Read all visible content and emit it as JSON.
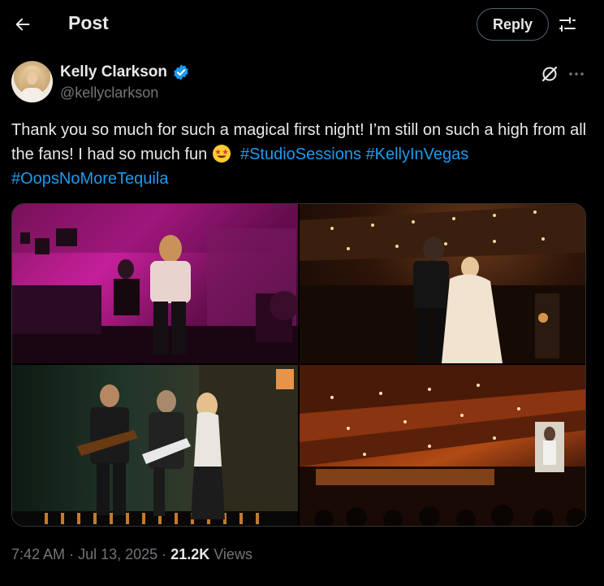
{
  "header": {
    "title": "Post",
    "reply_label": "Reply"
  },
  "icons": {
    "back": "arrow-left-icon",
    "filter": "sliders-icon",
    "verified": "verified-badge-icon",
    "grok": "grok-icon",
    "more": "more-horizontal-icon"
  },
  "author": {
    "name": "Kelly Clarkson",
    "handle": "@kellyclarkson"
  },
  "post": {
    "text_part1": "Thank you so much for such a magical first night! I’m still on such a high from all the fans! I had so much fun",
    "hashtags": [
      "#StudioSessions",
      "#KellyInVegas",
      "#OopsNoMoreTequila"
    ],
    "emoji": "star-struck-emoji"
  },
  "media": {
    "photo_count": 4
  },
  "meta": {
    "time": "7:42 AM",
    "separator": "·",
    "date": "Jul 13, 2025",
    "views_count": "21.2K",
    "views_label": "Views"
  },
  "colors": {
    "background": "#000000",
    "text": "#e7e9ea",
    "secondary": "#71767b",
    "link": "#1d9bf0",
    "border": "#2f3336"
  }
}
